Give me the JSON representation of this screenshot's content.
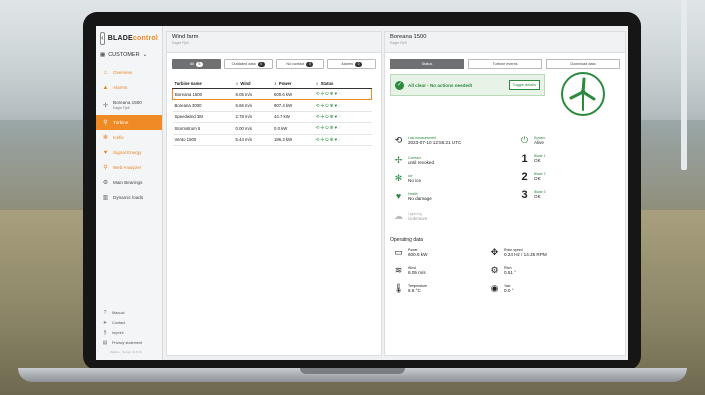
{
  "app": {
    "logo_text": "BLADE",
    "logo_accent": "control",
    "customer_label": "CUSTOMER"
  },
  "sidebar": {
    "items": [
      {
        "label": "Overview",
        "icon": "home-icon"
      },
      {
        "label": "Alarms",
        "icon": "warning-icon"
      },
      {
        "label": "Boreana 1500",
        "sublabel": "Eagle Fjell",
        "icon": "turbine-icon"
      },
      {
        "label": "Turbine",
        "icon": "search-icon"
      },
      {
        "label": "Icefix",
        "icon": "snowflake-icon"
      },
      {
        "label": "Signal Energy",
        "icon": "heart-icon"
      },
      {
        "label": "Web Analyzer",
        "icon": "search-icon"
      },
      {
        "label": "Main Bearings",
        "icon": "bearing-icon"
      },
      {
        "label": "Dynamic loads",
        "icon": "chart-icon"
      }
    ],
    "bottom": [
      {
        "label": "Manual",
        "icon": "help-icon"
      },
      {
        "label": "Contact",
        "icon": "send-icon"
      },
      {
        "label": "Imprint",
        "icon": "paragraph-icon"
      },
      {
        "label": "Privacy statement",
        "icon": "document-icon"
      }
    ],
    "version": "WebFe · Server v3.8.16"
  },
  "left_panel": {
    "title": "Wind farm",
    "subtitle": "Eagle Fjell",
    "filters": [
      {
        "label": "All",
        "count": "5"
      },
      {
        "label": "Outdated data",
        "count": "0"
      },
      {
        "label": "No contact",
        "count": "0"
      },
      {
        "label": "Alarms",
        "count": "0"
      }
    ],
    "columns": [
      "Turbine name",
      "Wind",
      "Power",
      "Status"
    ],
    "rows": [
      {
        "name": "Boreana 1500",
        "wind": "8.05 m/s",
        "power": "600.6 kW"
      },
      {
        "name": "Boreana 3000",
        "wind": "6.66 m/s",
        "power": "907.4 kW"
      },
      {
        "name": "Speedwind 3M",
        "wind": "2.78 m/s",
        "power": "44.7 kW"
      },
      {
        "name": "Stormstrom 5",
        "wind": "0.00 m/s",
        "power": "0.0 kW"
      },
      {
        "name": "Vento 1500",
        "wind": "5.44 m/s",
        "power": "186.3 kW"
      }
    ]
  },
  "right_panel": {
    "title": "Boreana 1500",
    "subtitle": "Eagle Fjell",
    "tabs": [
      "Status",
      "Turbine events",
      "Download data"
    ],
    "alert_text": "All clear - No actions needed!",
    "toggle_label": "Toggle details",
    "last_measurement_label": "Last measurement",
    "last_measurement_value": "2023-07-10 12:55:21 UTC",
    "system_label": "System",
    "system_value": "Alive",
    "contract_label": "Contract",
    "contract_value": "until revoked",
    "ice_label": "Ice",
    "ice_value": "No ice",
    "health_label": "Health",
    "health_value": "No damage",
    "unknown_label": "Lightning",
    "unknown_value": "Unknown",
    "blades": [
      {
        "num": "1",
        "label": "Blade 1",
        "value": "OK"
      },
      {
        "num": "2",
        "label": "Blade 2",
        "value": "OK"
      },
      {
        "num": "3",
        "label": "Blade 3",
        "value": "OK"
      }
    ],
    "operating_title": "Operating data",
    "power_label": "Power",
    "power_value": "600.6 kW",
    "rotor_label": "Rotor speed",
    "rotor_value": "0.24 Hz / 14.35 RPM",
    "wind_label": "Wind",
    "wind_value": "8.05 m/s",
    "pitch_label": "Pitch",
    "pitch_value": "0.51 °",
    "temp_label": "Temperature",
    "temp_value": "6.6 °C",
    "yaw_label": "Yaw",
    "yaw_value": "0.0 °"
  },
  "colors": {
    "accent": "#f08a24",
    "ok_green": "#2b8a3e"
  }
}
